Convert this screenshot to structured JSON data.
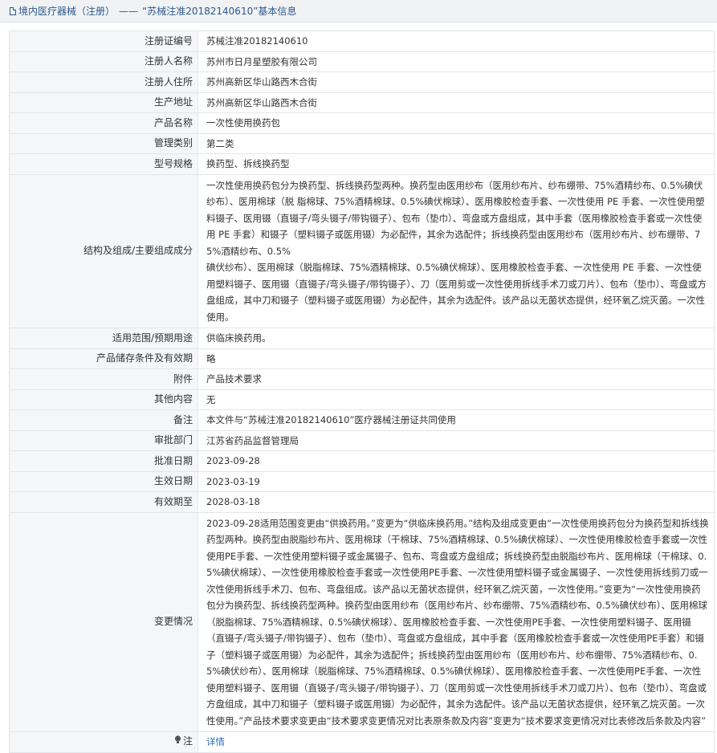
{
  "header": {
    "prefix": "境内医疗器械（注册）",
    "separator": "——",
    "title": "“苏械注准20182140610”基本信息"
  },
  "rows": [
    {
      "label": "注册证编号",
      "value": "苏械注准20182140610"
    },
    {
      "label": "注册人名称",
      "value": "苏州市日月星塑胶有限公司"
    },
    {
      "label": "注册人住所",
      "value": "苏州高新区华山路西木合街"
    },
    {
      "label": "生产地址",
      "value": "苏州高新区华山路西木合街"
    },
    {
      "label": "产品名称",
      "value": "一次性使用换药包"
    },
    {
      "label": "管理类别",
      "value": "第二类"
    },
    {
      "label": "型号规格",
      "value": "换药型、拆线换药型"
    },
    {
      "label": "结构及组成/主要组成成分",
      "value": "一次性使用换药包分为换药型、拆线换药型两种。换药型由医用纱布（医用纱布片、纱布绷带、75%酒精纱布、0.5%碘伏纱布）、医用棉球（脱 脂棉球、75%酒精棉球、0.5%碘伏棉球）、医用橡胶检查手套、一次性使用 PE 手套、一次性使用塑料镊子、医用镊（直镊子/弯头镊子/带钩镊子）、包布（垫巾）、弯盘或方盘组成，其中手套（医用橡胶检查手套或一次性使用 PE 手套）和镊子（塑料镊子或医用镊）为必配件，其余为选配件；拆线换药型由医用纱布（医用纱布片、纱布绷带、75%酒精纱布、0.5%\n碘伏纱布）、医用棉球（脱脂棉球、75%酒精棉球、0.5%碘伏棉球）、医用橡胶检查手套、一次性使用 PE 手套、一次性使用塑料镊子、医用镊（直镊子/弯头镊子/带钩镊子）、刀（医用剪或一次性使用拆线手术刀或刀片）、包布（垫巾）、弯盘或方盘组成，其中刀和镊子（塑料镊子或医用镊）为必配件，其余为选配件。该产品以无菌状态提供，经环氧乙烷灭菌。一次性使用。"
    },
    {
      "label": "适用范围/预期用途",
      "value": "供临床换药用。"
    },
    {
      "label": "产品储存条件及有效期",
      "value": "略"
    },
    {
      "label": "附件",
      "value": "产品技术要求"
    },
    {
      "label": "其他内容",
      "value": "无"
    },
    {
      "label": "备注",
      "value": "本文件与“苏械注准20182140610”医疗器械注册证共同使用"
    },
    {
      "label": "审批部门",
      "value": "江苏省药品监督管理局"
    },
    {
      "label": "批准日期",
      "value": "2023-09-28"
    },
    {
      "label": "生效日期",
      "value": "2023-03-19"
    },
    {
      "label": "有效期至",
      "value": "2028-03-18"
    },
    {
      "label": "变更情况",
      "value": "2023-09-28适用范围变更由“供换药用。”变更为“供临床换药用。”结构及组成变更由“一次性使用换药包分为换药型和拆线换药型两种。换药型由脱脂纱布片、医用棉球（干棉球、75%酒精棉球、0.5%碘伏棉球）、一次性使用橡胶检查手套或一次性使用PE手套、一次性使用塑料镊子或金属镊子、包布、弯盘或方盘组成；拆线换药型由脱脂纱布片、医用棉球（干棉球、0.5%碘伏棉球）、一次性使用橡胶检查手套或一次性使用PE手套、一次性使用塑料镊子或金属镊子、一次性使用拆线剪刀或一次性使用拆线手术刀、包布、弯盘组成。该产品以无菌状态提供，经环氧乙烷灭菌，一次性使用。”变更为“一次性使用换药包分为换药型、拆线换药型两种。换药型由医用纱布（医用纱布片、纱布绷带、75%酒精纱布、0.5%碘伏纱布）、医用棉球（脱脂棉球、75%酒精棉球、0.5%碘伏棉球）、医用橡胶检查手套、一次性使用PE手套、一次性使用塑料镊子、医用镊（直镊子/弯头镊子/带钩镊子）、包布（垫巾）、弯盘或方盘组成，其中手套（医用橡胶检查手套或一次性使用PE手套）和镊子（塑料镊子或医用镊）为必配件，其余为选配件；拆线换药型由医用纱布（医用纱布片、纱布绷带、75%酒精纱布、0.5%碘伏纱布）、医用棉球（脱脂棉球、75%酒精棉球、0.5%碘伏棉球）、医用橡胶检查手套、一次性使用PE手套、一次性使用塑料镊子、医用镊（直镊子/弯头镊子/带钩镊子）、刀（医用剪或一次性使用拆线手术刀或刀片）、包布（垫巾）、弯盘或方盘组成，其中刀和镊子（塑料镊子或医用镊）为必配件，其余为选配件。该产品以无菌状态提供，经环氧乙烷灭菌。一次性使用。”产品技术要求变更由“技术要求变更情况对比表原条款及内容”变更为“技术要求变更情况对比表修改后条款及内容”"
    }
  ],
  "note_row": {
    "label": "注",
    "link_text": "详情"
  },
  "icons": {
    "header": "document-icon",
    "note": "lightbulb-icon"
  },
  "colors": {
    "link": "#2c6fb3",
    "header_text": "#2c5a8c",
    "label_bg": "#f5f6f8"
  }
}
